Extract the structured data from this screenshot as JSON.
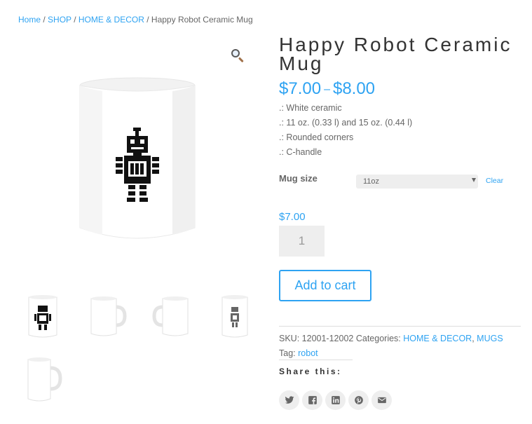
{
  "breadcrumb": {
    "home": "Home",
    "shop": "SHOP",
    "category": "HOME & DECOR",
    "current": "Happy Robot Ceramic Mug",
    "separator": "/"
  },
  "gallery": {
    "zoom_icon": "magnifier-icon",
    "thumbnails": [
      "robot-front",
      "mug-side",
      "mug-back",
      "robot-front-small",
      "mug-15oz-side"
    ]
  },
  "product": {
    "title": "Happy Robot Ceramic Mug",
    "price_min": "$7.00",
    "price_dash": "–",
    "price_max": "$8.00",
    "features": [
      ".: White ceramic",
      ".: 11 oz. (0.33 l) and 15 oz. (0.44 l)",
      ".: Rounded corners",
      ".: C-handle"
    ]
  },
  "variation": {
    "label": "Mug size",
    "selected": "11oz",
    "clear": "Clear",
    "price": "$7.00"
  },
  "cart": {
    "quantity": "1",
    "button": "Add to cart"
  },
  "meta": {
    "sku_label": "SKU:",
    "sku": "12001-12002",
    "categories_label": "Categories:",
    "category_1": "HOME & DECOR",
    "comma": ",",
    "category_2": "MUGS",
    "tag_label": "Tag:",
    "tag": "robot"
  },
  "share": {
    "title": "Share this:",
    "buttons": [
      "twitter-icon",
      "facebook-icon",
      "linkedin-icon",
      "pinterest-icon",
      "email-icon"
    ]
  },
  "colors": {
    "accent": "#2ea3f2",
    "text": "#666666",
    "heading": "#333333",
    "field_bg": "#eeeeee"
  }
}
